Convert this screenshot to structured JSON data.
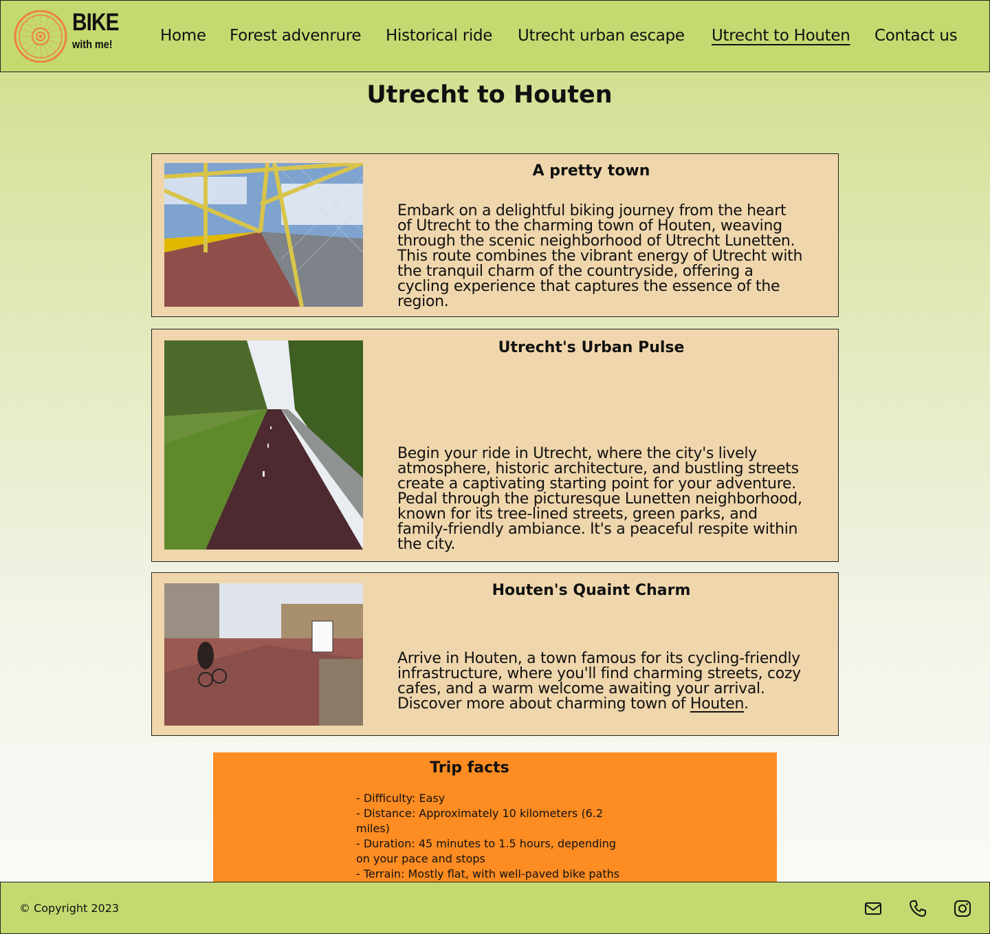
{
  "brand": {
    "name": "BIKE",
    "tagline": "with me!",
    "accent_color": "#f07f3c"
  },
  "nav": {
    "items": [
      {
        "label": "Home"
      },
      {
        "label": "Forest advenrure"
      },
      {
        "label": "Historical ride"
      },
      {
        "label": "Utrecht urban escape"
      },
      {
        "label": "Utrecht to Houten",
        "active": true
      },
      {
        "label": "Contact us"
      }
    ]
  },
  "page": {
    "title": "Utrecht to Houten"
  },
  "cards": [
    {
      "title": "A pretty town",
      "text": "Embark on a delightful biking journey from the heart of Utrecht to the charming town of Houten, weaving through the scenic neighborhood of Utrecht Lunetten. This route combines the vibrant energy of Utrecht with the tranquil charm of the countryside, offering a cycling experience that captures the essence of the region."
    },
    {
      "title": "Utrecht's Urban Pulse",
      "text": "Begin your ride in Utrecht, where the city's lively atmosphere, historic architecture, and bustling streets create a captivating starting point for your adventure. Pedal through the picturesque Lunetten neighborhood, known for its tree-lined streets, green parks, and family-friendly ambiance. It's a peaceful respite within the city."
    },
    {
      "title": "Houten's Quaint Charm",
      "text_before_link": "Arrive in Houten, a town famous for its cycling-friendly infrastructure, where you'll find charming streets, cozy cafes, and a warm welcome awaiting your arrival. Discover more about charming town of ",
      "link": "Houten",
      "text_after_link": "."
    }
  ],
  "trip_facts": {
    "title": "Trip facts",
    "items": [
      "- Difficulty: Easy",
      "- Distance: Approximately 10 kilometers (6.2 miles)",
      "- Duration: 45 minutes to 1.5 hours, depending on your pace and stops",
      "- Terrain: Mostly flat, with well-paved bike paths"
    ]
  },
  "footer": {
    "copyright": "© Copyright 2023",
    "icons": [
      "mail-icon",
      "phone-icon",
      "instagram-icon"
    ]
  },
  "colors": {
    "header_bg": "#c4d970",
    "card_bg": "#efd6ac",
    "facts_bg": "#fd8c22"
  }
}
